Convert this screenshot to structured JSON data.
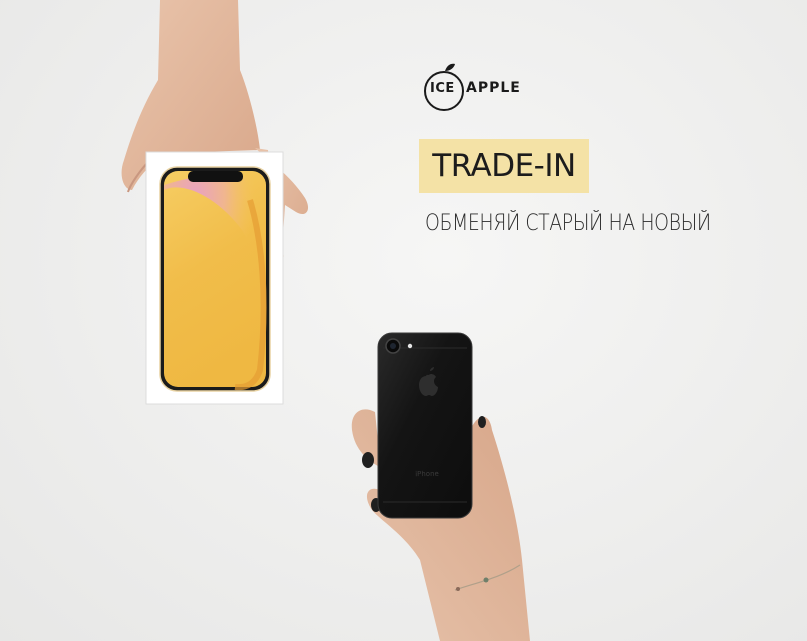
{
  "logo": {
    "ice": "ICE",
    "apple": "APPLE"
  },
  "headline": {
    "badge": "TRADE-IN",
    "tagline": "ОБМЕНЯЙ СТАРЫЙ НА НОВЫЙ"
  },
  "old_phone": {
    "back_label": "iPhone"
  },
  "colors": {
    "background": "#efefee",
    "badge": "#f4e2a6",
    "text": "#1c1c1c",
    "new_phone_wallpaper": "#f2c04f",
    "old_phone_body": "#121212"
  }
}
